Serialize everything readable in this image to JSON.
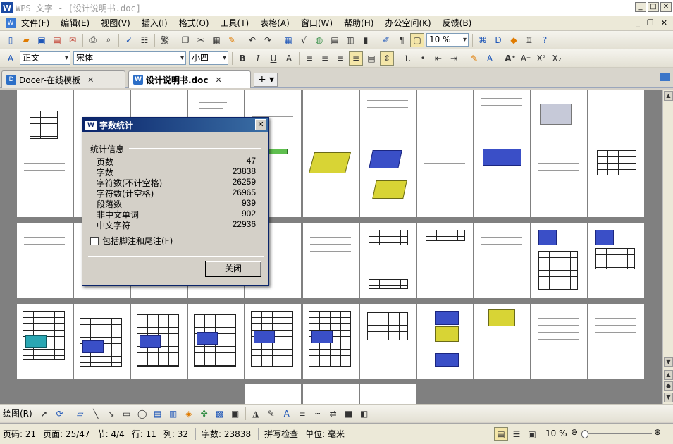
{
  "window": {
    "app_logo": "W",
    "title": "WPS 文字 - [设计说明书.doc]",
    "min": "_",
    "max": "□",
    "close": "✕"
  },
  "menu": {
    "items": [
      "文件(F)",
      "编辑(E)",
      "视图(V)",
      "插入(I)",
      "格式(O)",
      "工具(T)",
      "表格(A)",
      "窗口(W)",
      "帮助(H)",
      "办公空间(K)",
      "反馈(B)"
    ],
    "right_controls": [
      "_",
      "❐",
      "✕"
    ]
  },
  "toolbar_format": {
    "style": "正文",
    "font": "宋体",
    "size": "小四",
    "zoom": "10 %"
  },
  "tabs": [
    {
      "label": "Docer-在线模板",
      "close": "✕"
    },
    {
      "label": "设计说明书.doc",
      "close": "✕"
    }
  ],
  "tab_add": "+ ▾",
  "dialog": {
    "title": "字数统计",
    "close": "✕",
    "group": "统计信息",
    "stats": [
      {
        "label": "页数",
        "value": "47"
      },
      {
        "label": "字数",
        "value": "23838"
      },
      {
        "label": "字符数(不计空格)",
        "value": "26259"
      },
      {
        "label": "字符数(计空格)",
        "value": "26965"
      },
      {
        "label": "段落数",
        "value": "939"
      },
      {
        "label": "非中文单词",
        "value": "902"
      },
      {
        "label": "中文字符",
        "value": "22936"
      }
    ],
    "checkbox": "包括脚注和尾注(F)",
    "ok": "关闭"
  },
  "drawbar": {
    "label": "绘图(R)"
  },
  "status": {
    "page_code": "页码: 21",
    "page": "页面: 25/47",
    "section": "节: 4/4",
    "row": "行: 11",
    "col": "列: 32",
    "words": "字数: 23838",
    "spell": "拼写检查",
    "unit": "单位: 毫米",
    "zoom": "10 %"
  },
  "colors": {
    "titlebar_active": "#0a246a",
    "doc_background": "#808080",
    "accent_blue": "#1e56b8"
  }
}
